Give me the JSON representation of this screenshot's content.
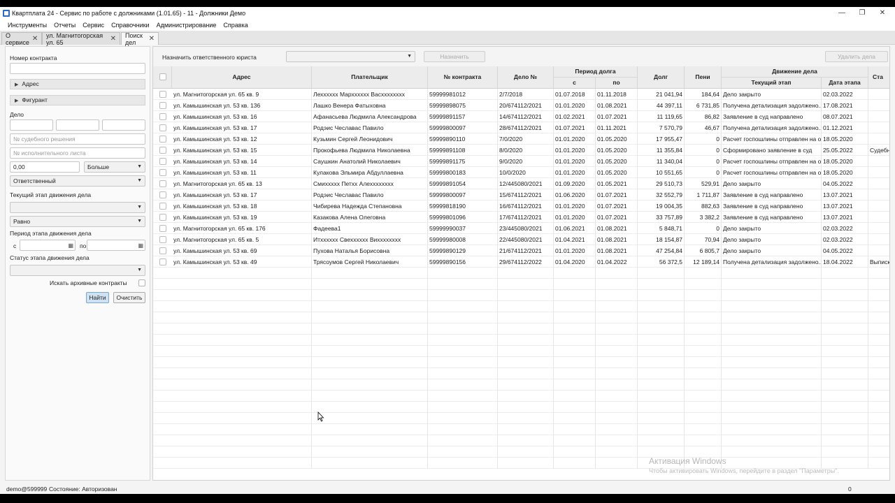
{
  "window": {
    "title": "Квартплата 24 - Сервис по работе с должниками (1.01.65) - 11 - Должники Демо",
    "minimize": "—",
    "maximize": "❐",
    "close": "✕"
  },
  "menu": [
    "Инструменты",
    "Отчеты",
    "Сервис",
    "Справочники",
    "Администрирование",
    "Справка"
  ],
  "tabs": [
    {
      "label": "О сервисе",
      "close": "✕"
    },
    {
      "label": "ул. Магнитогорская ул. 65",
      "close": "✕"
    },
    {
      "label": "Поиск дел",
      "close": "✕"
    }
  ],
  "filter": {
    "contract_label": "Номер контракта",
    "contract_value": "",
    "address_section": "Адрес",
    "figurant_section": "Фигурант",
    "case_label": "Дело",
    "court_decision_placeholder": "№ судебного решения",
    "writ_placeholder": "№ исполнительного листа",
    "amount_value": "0,00",
    "amount_compare": "Больше",
    "responsible": "Ответственный",
    "stage_label": "Текущий этап движения дела",
    "stage_value": "",
    "stage_compare": "Равно",
    "period_label": "Период этапа движения дела",
    "period_from": "с",
    "period_to": "по",
    "status_label": "Статус этапа движения дела",
    "status_value": "",
    "archive_label": "Искать архивные контракты",
    "find_button": "Найти",
    "clear_button": "Очистить"
  },
  "toolbar": {
    "assign_label": "Назначить ответственного юриста",
    "assign_select": "",
    "assign_button": "Назначить",
    "delete_button": "Удалить дела"
  },
  "table": {
    "headers": {
      "address": "Адрес",
      "payer": "Плательщик",
      "contract": "№ контракта",
      "case": "Дело №",
      "period": "Период долга",
      "period_from": "с",
      "period_to": "по",
      "debt": "Долг",
      "penalty": "Пени",
      "movement": "Движение дела",
      "stage": "Текущий этап",
      "stage_date": "Дата этапа",
      "status": "Ста"
    },
    "rows": [
      {
        "address": "ул. Магнитогорская ул. 65 кв. 9",
        "payer": "Лехххххх Мархххххх Васхххххххх",
        "contract": "59999981012",
        "case": "2/7/2018",
        "from": "01.07.2018",
        "to": "01.11.2018",
        "debt": "21 041,94",
        "penalty": "184,64",
        "stage": "Дело закрыто",
        "date": "02.03.2022",
        "status": ""
      },
      {
        "address": "ул. Камышинская ул. 53 кв. 136",
        "payer": "Лашко Венера Фатыховна",
        "contract": "59999898075",
        "case": "20/674112/2021",
        "from": "01.01.2020",
        "to": "01.08.2021",
        "debt": "44 397,11",
        "penalty": "6 731,85",
        "stage": "Получена детализация задолжено...",
        "date": "17.08.2021",
        "status": ""
      },
      {
        "address": "ул. Камышинская ул. 53 кв. 16",
        "payer": "Афанасьева Людмила Александрова",
        "contract": "59999891157",
        "case": "14/674112/2021",
        "from": "01.02.2021",
        "to": "01.07.2021",
        "debt": "11 119,65",
        "penalty": "86,82",
        "stage": "Заявление в суд направлено",
        "date": "08.07.2021",
        "status": ""
      },
      {
        "address": "ул. Камышинская ул. 53 кв. 17",
        "payer": "Родэис Чеславас Павило",
        "contract": "59999800097",
        "case": "28/674112/2021",
        "from": "01.07.2021",
        "to": "01.11.2021",
        "debt": "7 570,79",
        "penalty": "46,67",
        "stage": "Получена детализация задолжено...",
        "date": "01.12.2021",
        "status": ""
      },
      {
        "address": "ул. Камышинская ул. 53 кв. 12",
        "payer": "Кузьмин Сергей Леонидович",
        "contract": "59999890110",
        "case": "7/0/2020",
        "from": "01.01.2020",
        "to": "01.05.2020",
        "debt": "17 955,47",
        "penalty": "0",
        "stage": "Расчет госпошлины отправлен на о...",
        "date": "18.05.2020",
        "status": ""
      },
      {
        "address": "ул. Камышинская ул. 53 кв. 15",
        "payer": "Прокофьева Людмила Николаевна",
        "contract": "59999891108",
        "case": "8/0/2020",
        "from": "01.01.2020",
        "to": "01.05.2020",
        "debt": "11 355,84",
        "penalty": "0",
        "stage": "Сформировано заявление в суд",
        "date": "25.05.2022",
        "status": "Судебн"
      },
      {
        "address": "ул. Камышинская ул. 53 кв. 14",
        "payer": "Саушкин Анатолий Николаевич",
        "contract": "59999891175",
        "case": "9/0/2020",
        "from": "01.01.2020",
        "to": "01.05.2020",
        "debt": "11 340,04",
        "penalty": "0",
        "stage": "Расчет госпошлины отправлен на о...",
        "date": "18.05.2020",
        "status": ""
      },
      {
        "address": "ул. Камышинская ул. 53 кв. 11",
        "payer": "Кулакова Эльмира Абдуллаевна",
        "contract": "59999800183",
        "case": "10/0/2020",
        "from": "01.01.2020",
        "to": "01.05.2020",
        "debt": "10 551,65",
        "penalty": "0",
        "stage": "Расчет госпошлины отправлен на о...",
        "date": "18.05.2020",
        "status": ""
      },
      {
        "address": "ул. Магнитогорская ул. 65 кв. 13",
        "payer": "Смиххххх Петхх Алехххххххх",
        "contract": "59999891054",
        "case": "12/445080/2021",
        "from": "01.09.2020",
        "to": "01.05.2021",
        "debt": "29 510,73",
        "penalty": "529,91",
        "stage": "Дело закрыто",
        "date": "04.05.2022",
        "status": ""
      },
      {
        "address": "ул. Камышинская ул. 53 кв. 17",
        "payer": "Родэис Чеславас Павило",
        "contract": "59999800097",
        "case": "15/674112/2021",
        "from": "01.06.2020",
        "to": "01.07.2021",
        "debt": "32 552,79",
        "penalty": "1 711,87",
        "stage": "Заявление в суд направлено",
        "date": "13.07.2021",
        "status": ""
      },
      {
        "address": "ул. Камышинская ул. 53 кв. 18",
        "payer": "Чибирева Надежда Степановна",
        "contract": "59999818190",
        "case": "16/674112/2021",
        "from": "01.01.2020",
        "to": "01.07.2021",
        "debt": "19 004,35",
        "penalty": "882,63",
        "stage": "Заявление в суд направлено",
        "date": "13.07.2021",
        "status": ""
      },
      {
        "address": "ул. Камышинская ул. 53 кв. 19",
        "payer": "Казакова Алена Олеговна",
        "contract": "59999801096",
        "case": "17/674112/2021",
        "from": "01.01.2020",
        "to": "01.07.2021",
        "debt": "33 757,89",
        "penalty": "3 382,2",
        "stage": "Заявление в суд направлено",
        "date": "13.07.2021",
        "status": ""
      },
      {
        "address": "ул. Магнитогорская ул. 65 кв. 176",
        "payer": "Фадеева1",
        "contract": "59999990037",
        "case": "23/445080/2021",
        "from": "01.06.2021",
        "to": "01.08.2021",
        "debt": "5 848,71",
        "penalty": "0",
        "stage": "Дело закрыто",
        "date": "02.03.2022",
        "status": ""
      },
      {
        "address": "ул. Магнитогорская ул. 65 кв. 5",
        "payer": "Итхххххх Свехххххх Вихххххххх",
        "contract": "59999980008",
        "case": "22/445080/2021",
        "from": "01.04.2021",
        "to": "01.08.2021",
        "debt": "18 154,87",
        "penalty": "70,94",
        "stage": "Дело закрыто",
        "date": "02.03.2022",
        "status": ""
      },
      {
        "address": "ул. Камышинская ул. 53 кв. 69",
        "payer": "Пухова Наталья Борисовна",
        "contract": "59999890129",
        "case": "21/674112/2021",
        "from": "01.01.2020",
        "to": "01.08.2021",
        "debt": "47 254,84",
        "penalty": "6 805,7",
        "stage": "Дело закрыто",
        "date": "04.05.2022",
        "status": ""
      },
      {
        "address": "ул. Камышинская ул. 53 кв. 49",
        "payer": "Трясоумов Сергей Николаевич",
        "contract": "59999890156",
        "case": "29/674112/2022",
        "from": "01.04.2020",
        "to": "01.04.2022",
        "debt": "56 372,5",
        "penalty": "12 189,14",
        "stage": "Получена детализация задолжено...",
        "date": "18.04.2022",
        "status": "Выписк"
      }
    ]
  },
  "watermark": {
    "title": "Активация Windows",
    "subtitle": "Чтобы активировать Windows, перейдите в раздел \"Параметры\"."
  },
  "status": {
    "user": "demo@599999",
    "state": "Состояние: Авторизован",
    "count": "0"
  }
}
